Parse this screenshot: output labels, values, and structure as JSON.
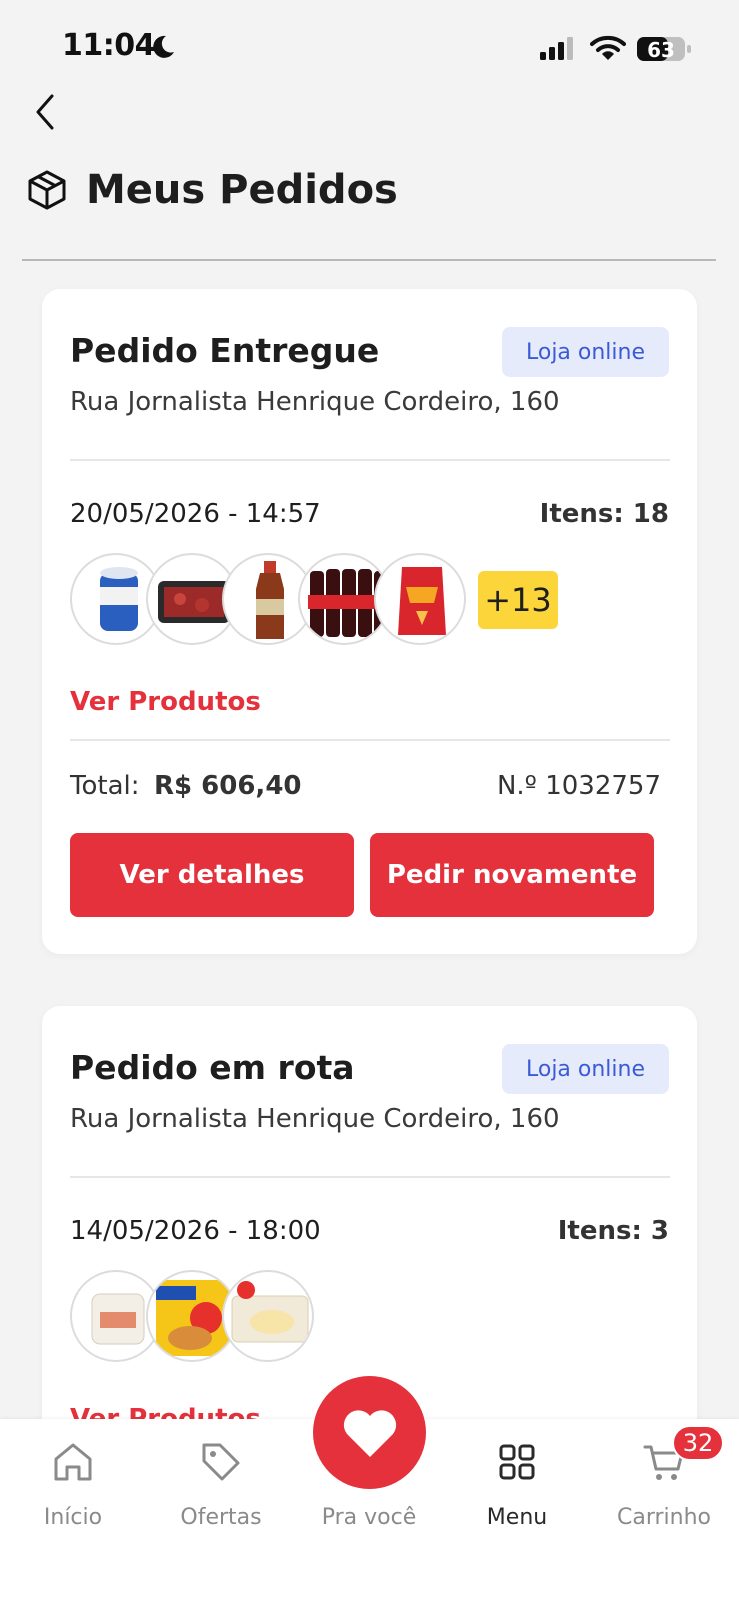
{
  "status_bar": {
    "time": "11:04",
    "battery": "63"
  },
  "header": {
    "title": "Meus Pedidos"
  },
  "orders": [
    {
      "status": "Pedido Entregue",
      "store": "Loja online",
      "address": "Rua Jornalista Henrique Cordeiro, 160",
      "date": "20/05/2026 - 14:57",
      "items": "Itens: 18",
      "more": "+13",
      "view_products": "Ver Produtos",
      "total_label": "Total:",
      "total_value": "R$ 606,40",
      "number": "N.º 1032757",
      "details_label": "Ver detalhes",
      "reorder_label": "Pedir novamente"
    },
    {
      "status": "Pedido em rota",
      "store": "Loja online",
      "address": "Rua Jornalista Henrique Cordeiro, 160",
      "date": "14/05/2026 - 18:00",
      "items": "Itens: 3",
      "view_products": "Ver Produtos"
    }
  ],
  "nav": {
    "items": [
      {
        "label": "Início",
        "icon": "home-icon"
      },
      {
        "label": "Ofertas",
        "icon": "tag-icon"
      },
      {
        "label": "Pra você",
        "icon": "heart-icon"
      },
      {
        "label": "Menu",
        "icon": "grid-icon"
      },
      {
        "label": "Carrinho",
        "icon": "cart-icon"
      }
    ],
    "cart_count": "32"
  },
  "colors": {
    "accent": "#e4313b",
    "badge_bg": "#e6ebfb",
    "badge_text": "#3b5bd6",
    "more_badge": "#fcd53a"
  }
}
